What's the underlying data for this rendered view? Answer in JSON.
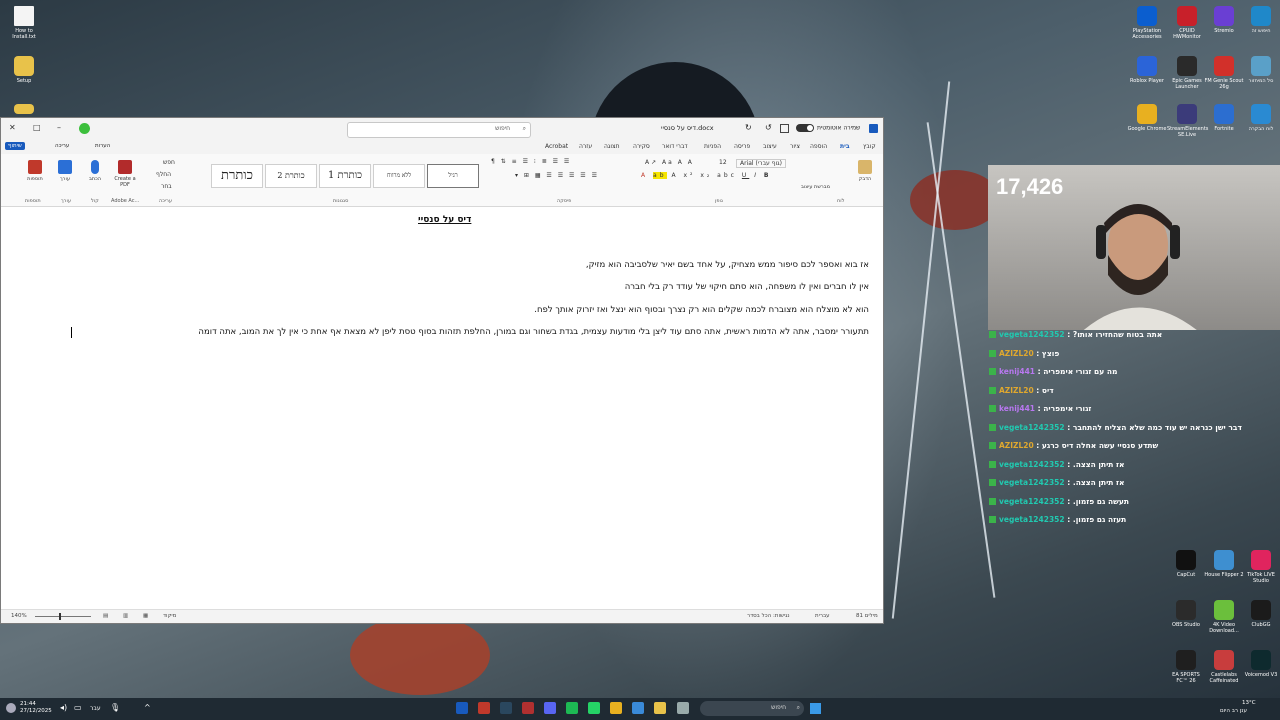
{
  "desktop": {
    "left_icons": [
      "How to Install.txt",
      "Setup"
    ],
    "right_icons": [
      {
        "label": "PlayStation Accessories",
        "color": "#0b5ecf"
      },
      {
        "label": "CPUID HWMonitor",
        "color": "#c8202a"
      },
      {
        "label": "Stremio",
        "color": "#6a3fd3"
      },
      {
        "label": "חיפוש זה",
        "color": "#1f88c9"
      },
      {
        "label": "Roblox Player",
        "color": "#2b64d8"
      },
      {
        "label": "Epic Games Launcher",
        "color": "#2a2a2a"
      },
      {
        "label": "FM Genie Scout 26g",
        "color": "#d2302a"
      },
      {
        "label": "סל המיחזור",
        "color": "#5aa0c8"
      },
      {
        "label": "Google Chrome",
        "color": "#e8b020"
      },
      {
        "label": "StreamElements SE.Live",
        "color": "#3b3b7a"
      },
      {
        "label": "Fortnite",
        "color": "#2c6ed0"
      },
      {
        "label": "לוח הבקרה",
        "color": "#2a8ad2"
      },
      {
        "label": "CapCut",
        "color": "#111111"
      },
      {
        "label": "House Flipper 2",
        "color": "#3e8fd0"
      },
      {
        "label": "TikTok LIVE Studio",
        "color": "#e0245e"
      },
      {
        "label": "OBS Studio",
        "color": "#2b2b2b"
      },
      {
        "label": "4K Video Download...",
        "color": "#6bbf3c"
      },
      {
        "label": "ClubGG",
        "color": "#1b1b1b"
      },
      {
        "label": "EA SPORTS FC™ 26",
        "color": "#1f1f1f"
      },
      {
        "label": "Castlelabs Caffeinated",
        "color": "#c83d3d"
      },
      {
        "label": "Voicemod V3",
        "color": "#0e2a2e"
      }
    ]
  },
  "word": {
    "search_placeholder": "חיפוש",
    "doc_title": "דיס על סנסיי.docx",
    "autosave_label": "שמירה אוטומטית",
    "tabs": [
      "קובץ",
      "בית",
      "הוספה",
      "ציור",
      "עיצוב",
      "פריסה",
      "הפניות",
      "דברי דואר",
      "סקירה",
      "תצוגה",
      "עזרה",
      "Acrobat"
    ],
    "active_tab": "בית",
    "comments_button": "הערות",
    "edit_button": "עריכה",
    "share_button": "שיתוף",
    "ribbon_groups": {
      "clipboard": "לוח",
      "font": "גופן",
      "paragraph": "פיסקה",
      "styles": "סגנונות",
      "editing": "עריכה",
      "voice": "קול",
      "editor": "עורך",
      "adobe": "Adobe Ac...",
      "addins": "תוספות"
    },
    "ribbon_buttons": {
      "paste": "הדבק",
      "format_painter": "מברשת עיצוב",
      "font_name": "Arial (גוף עברי)",
      "font_size": "12",
      "find": "חפש",
      "replace": "החלף",
      "select": "בחר",
      "create_pdf": "Create a PDF",
      "dictate": "הכתב",
      "editor": "עורך",
      "addins": "תוספות"
    },
    "styles": [
      "רגיל",
      "ללא מרווח",
      "כותרת 1",
      "כותרת 2",
      "כותרת"
    ],
    "document": {
      "heading": "דיס על סנסיי",
      "paragraphs": [
        "אז בוא ואספר לכם סיפור ממש מצחיק, על אחד בשם יאיר שלסביבה הוא מזיק,",
        "אין לו חברים ואין לו משפחה, הוא סתם חיקוי של עודד רק בלי חברה",
        "הוא לא מוצלח הוא מצוברח לכמה שקלים הוא רק נצרך ובסוף הוא ינצל ואז יזרוק אותך לפח.",
        "תתעורר ימסבר, אתה לא הדמות ראשית, אתה סתם עוד ליצן בלי מודעות עצמית, בגדת בשחור וגם במורן, החלפת תזהות בסוף טסת ליפן לא מצאת אף אחת כי אין לך את המוב, אתה דומה"
      ]
    },
    "status": {
      "words": "81 מילים",
      "language": "עברית",
      "accessibility": "נגישות: הכל בסדר",
      "focus": "מיקוד",
      "zoom": "140%"
    }
  },
  "stream": {
    "viewer_count": "17,426",
    "chat": [
      {
        "user": "vegeta1242352",
        "color": "#21c9b0",
        "text": "?אתה בטוח שהחזירו אותו"
      },
      {
        "user": "AZIZL20",
        "color": "#e0a82e",
        "text": "פוצץ"
      },
      {
        "user": "kenij441",
        "color": "#b878f0",
        "text": "מה עם זגורי אימפריה"
      },
      {
        "user": "AZIZL20",
        "color": "#e0a82e",
        "text": "דיס"
      },
      {
        "user": "kenij441",
        "color": "#b878f0",
        "text": "זגורי אימפריה"
      },
      {
        "user": "vegeta1242352",
        "color": "#21c9b0",
        "text": "דבר ישן כנראה יש עוד כמה שלא הצליח להתחבר"
      },
      {
        "user": "AZIZL20",
        "color": "#e0a82e",
        "text": "שתדע סנסיי עשה אחלה דיס כרגע"
      },
      {
        "user": "vegeta1242352",
        "color": "#21c9b0",
        "text": ".אז תיתן הצצה"
      },
      {
        "user": "vegeta1242352",
        "color": "#21c9b0",
        "text": ".אז תיתן הצצה"
      },
      {
        "user": "vegeta1242352",
        "color": "#21c9b0",
        "text": ".תעשה גם פזמון"
      },
      {
        "user": "vegeta1242352",
        "color": "#21c9b0",
        "text": ".תעזה גם פזמון"
      }
    ]
  },
  "taskbar": {
    "time": "21:44",
    "date": "27/12/2025",
    "lang": "עבר",
    "search_placeholder": "חיפוש",
    "weather": "13°C",
    "weather_desc": "ענן רב היום"
  }
}
